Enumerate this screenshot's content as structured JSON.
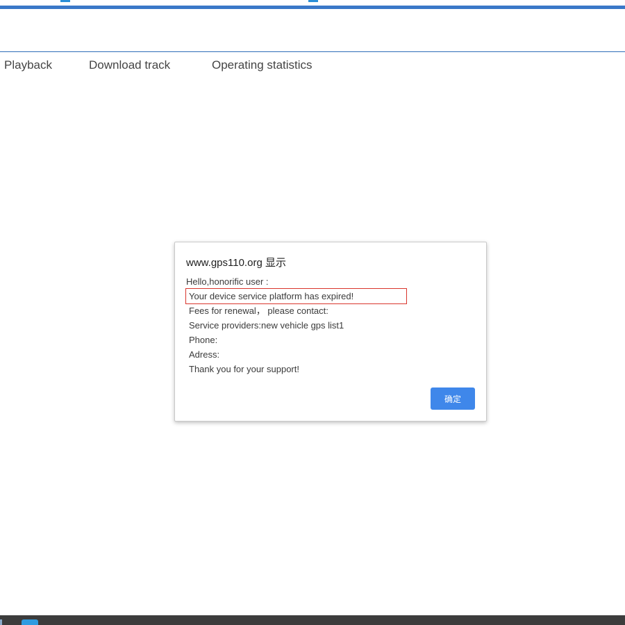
{
  "nav": {
    "items": [
      {
        "label": "Playback"
      },
      {
        "label": "Download track"
      },
      {
        "label": "Operating statistics"
      }
    ]
  },
  "dialog": {
    "title": "www.gps110.org 显示",
    "lines": [
      "Hello,honorific user :",
      "Your device service platform has expired!",
      "Fees for renewal， please contact:",
      "Service providers:new vehicle gps list1",
      "Phone:",
      "Adress:",
      "Thank you for your support!"
    ],
    "ok_label": "确定"
  },
  "colors": {
    "accent": "#3a78c8",
    "ok_button": "#3f87ea",
    "highlight_border": "#d9342b",
    "taskbar": "#3c3c3c"
  }
}
